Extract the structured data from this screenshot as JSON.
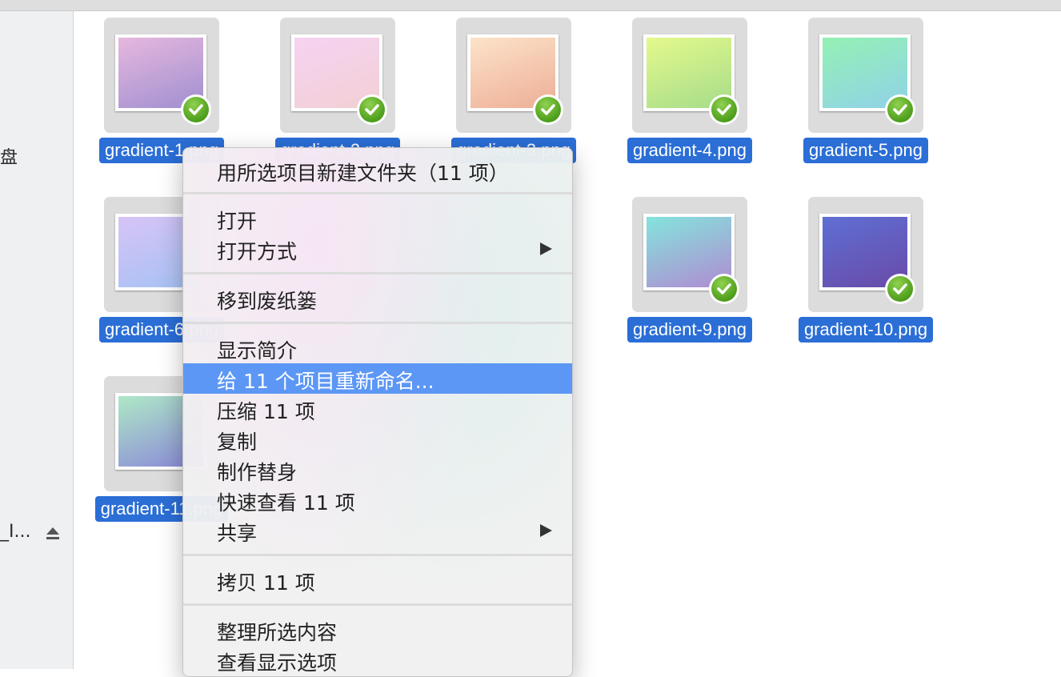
{
  "sidebar": {
    "disk_label": "盘",
    "device_label": "_I...",
    "eject_icon": "eject-icon"
  },
  "files": [
    {
      "name": "gradient-1.png",
      "gradient": [
        "#e6b8de",
        "#a08fd0"
      ]
    },
    {
      "name": "gradient-2.png",
      "gradient": [
        "#f6d3f2",
        "#f2cfd4"
      ]
    },
    {
      "name": "gradient-3.png",
      "gradient": [
        "#fce3ca",
        "#eeae96"
      ]
    },
    {
      "name": "gradient-4.png",
      "gradient": [
        "#e4f98c",
        "#a6dc8a"
      ]
    },
    {
      "name": "gradient-5.png",
      "gradient": [
        "#94f1b4",
        "#90d2e8"
      ]
    },
    {
      "name": "gradient-6.png",
      "gradient": [
        "#d8c3f6",
        "#a4c2f4"
      ]
    },
    {
      "name": "gradient-9.png",
      "gradient": [
        "#84e4dc",
        "#b08bd2"
      ]
    },
    {
      "name": "gradient-10.png",
      "gradient": [
        "#5e6fd4",
        "#6a4aa8"
      ]
    },
    {
      "name": "gradient-11.png",
      "gradient": [
        "#aee8c6",
        "#8a88d8"
      ]
    }
  ],
  "hidden_label_fragments": [
    "gradient-1.png",
    "gradient-2.png",
    "gradient-3.png",
    "gradient-",
    "png",
    "ng",
    "gradient-1"
  ],
  "context_menu": {
    "new_folder": "用所选项目新建文件夹（11 项）",
    "open": "打开",
    "open_with": "打开方式",
    "move_to_trash": "移到废纸篓",
    "get_info": "显示简介",
    "rename": "给 11 个项目重新命名...",
    "compress": "压缩 11 项",
    "duplicate": "复制",
    "make_alias": "制作替身",
    "quick_look": "快速查看 11 项",
    "share": "共享",
    "copy": "拷贝 11 项",
    "clean_up": "整理所选内容",
    "view_options": "查看显示选项",
    "highlight_color": "#5c97f5",
    "submenu_icon": "chevron-right-icon"
  },
  "selection_color": "#2b6ed6",
  "badge_color": "#5aa82a"
}
